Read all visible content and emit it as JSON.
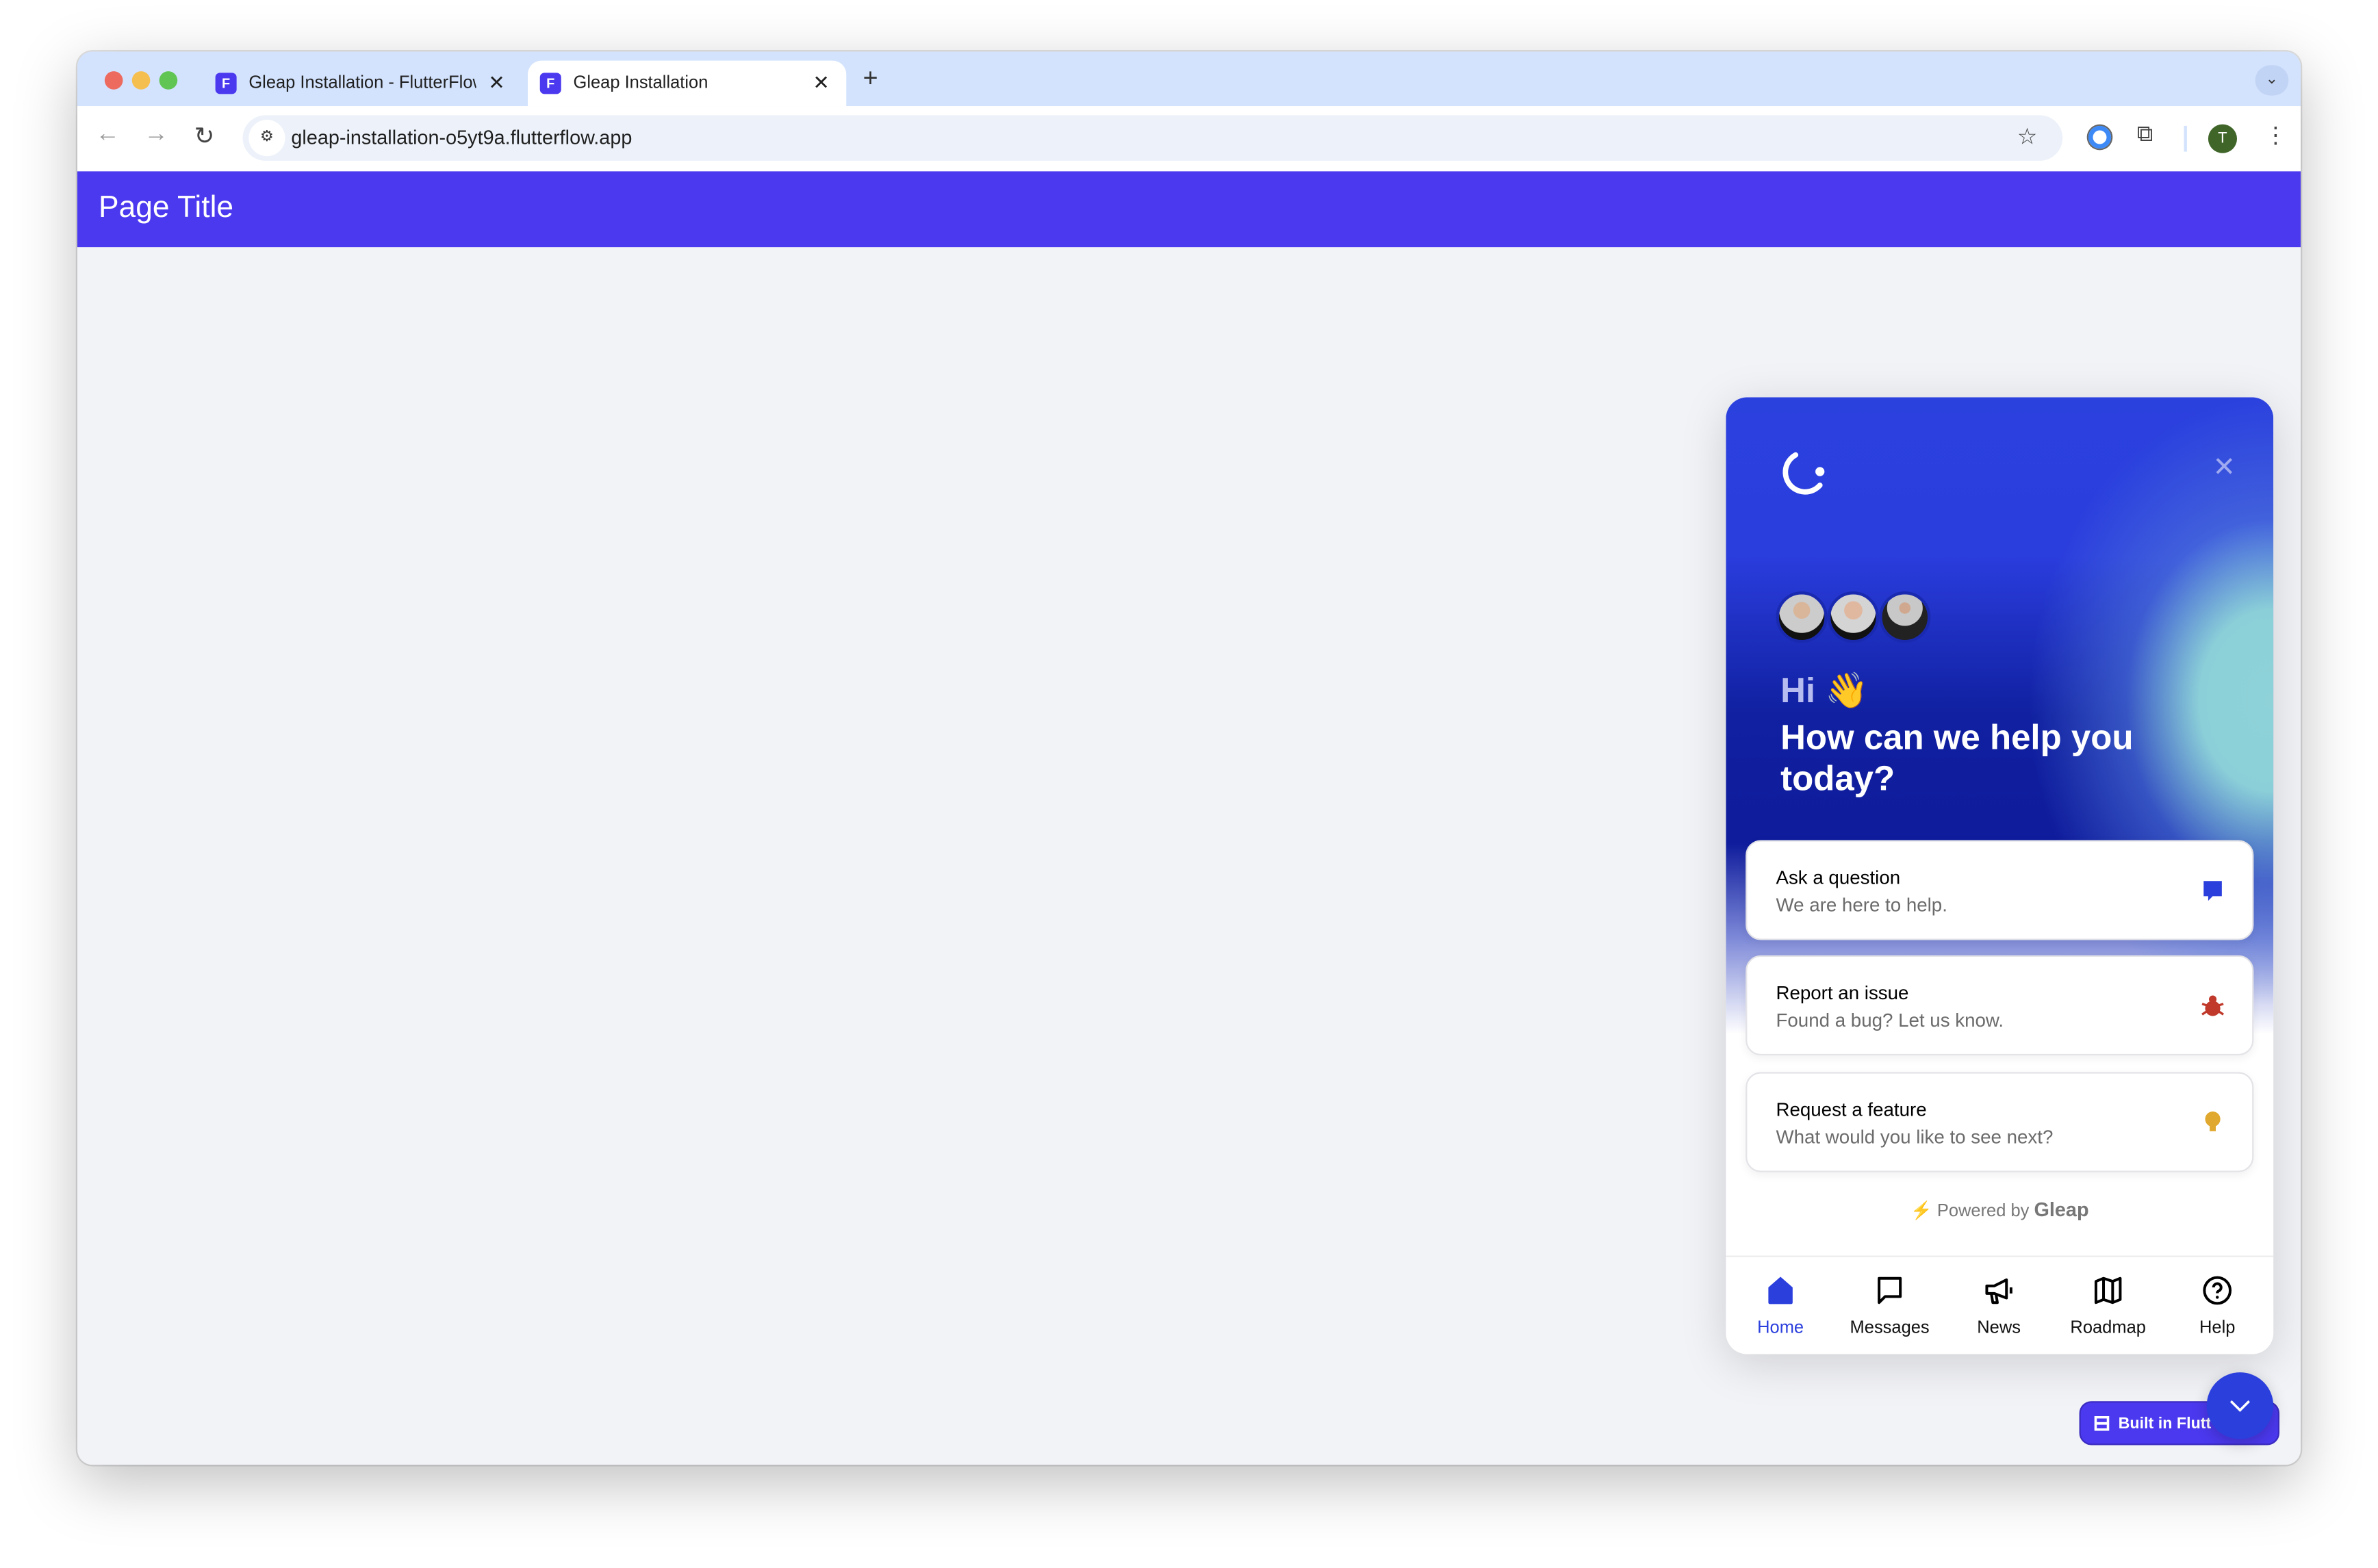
{
  "browser": {
    "tabs": [
      {
        "title": "Gleap Installation - FlutterFlow",
        "active": false
      },
      {
        "title": "Gleap Installation",
        "active": true
      }
    ],
    "url": "gleap-installation-o5yt9a.flutterflow.app",
    "profile_initial": "T",
    "icons": [
      "back-icon",
      "forward-icon",
      "reload-icon",
      "site-settings-icon",
      "star-icon",
      "1password-icon",
      "extensions-icon",
      "menu-icon"
    ]
  },
  "app": {
    "page_title": "Page Title",
    "header_color": "#4b39ef"
  },
  "widget": {
    "greeting": "Hi 👋",
    "headline": "How can we help you today?",
    "cards": [
      {
        "title": "Ask a question",
        "subtitle": "We are here to help.",
        "icon": "chat-icon"
      },
      {
        "title": "Report an issue",
        "subtitle": "Found a bug? Let us know.",
        "icon": "bug-icon"
      },
      {
        "title": "Request a feature",
        "subtitle": "What would you like to see next?",
        "icon": "lightbulb-icon"
      }
    ],
    "powered_by": "Powered by",
    "brand": "Gleap",
    "nav": [
      {
        "label": "Home",
        "active": true
      },
      {
        "label": "Messages"
      },
      {
        "label": "News"
      },
      {
        "label": "Roadmap"
      },
      {
        "label": "Help"
      }
    ],
    "accent": "#2b3fdd"
  },
  "badge": {
    "label": "Built in Flutt"
  }
}
